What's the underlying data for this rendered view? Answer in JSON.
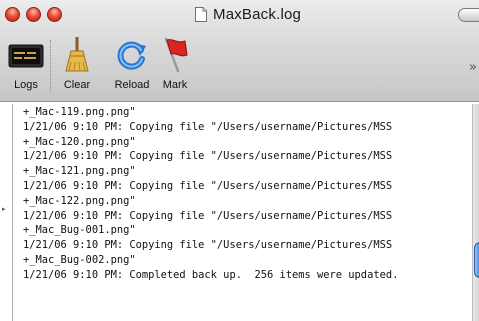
{
  "window": {
    "title": "MaxBack.log",
    "buttons": {
      "close": "close",
      "minimize": "minimize",
      "zoom": "zoom"
    },
    "colors": {
      "close": "#e8472f",
      "minimize": "#e8472f",
      "zoom": "#e8472f"
    }
  },
  "toolbar": {
    "items": [
      {
        "label": "Logs",
        "icon": "console-icon"
      },
      {
        "label": "Clear",
        "icon": "broom-icon"
      },
      {
        "label": "Reload",
        "icon": "reload-icon"
      },
      {
        "label": "Mark",
        "icon": "flag-icon"
      }
    ],
    "overflow": "»"
  },
  "log": {
    "lines": [
      "+_Mac-119.png.png\"",
      "1/21/06 9:10 PM: Copying file \"/Users/username/Pictures/MSS",
      "+_Mac-120.png.png\"",
      "1/21/06 9:10 PM: Copying file \"/Users/username/Pictures/MSS",
      "+_Mac-121.png.png\"",
      "1/21/06 9:10 PM: Copying file \"/Users/username/Pictures/MSS",
      "+_Mac-122.png.png\"",
      "1/21/06 9:10 PM: Copying file \"/Users/username/Pictures/MSS",
      "+_Mac_Bug-001.png\"",
      "1/21/06 9:10 PM: Copying file \"/Users/username/Pictures/MSS",
      "+_Mac_Bug-002.png\"",
      "1/21/06 9:10 PM: Completed back up.  256 items were updated."
    ]
  }
}
